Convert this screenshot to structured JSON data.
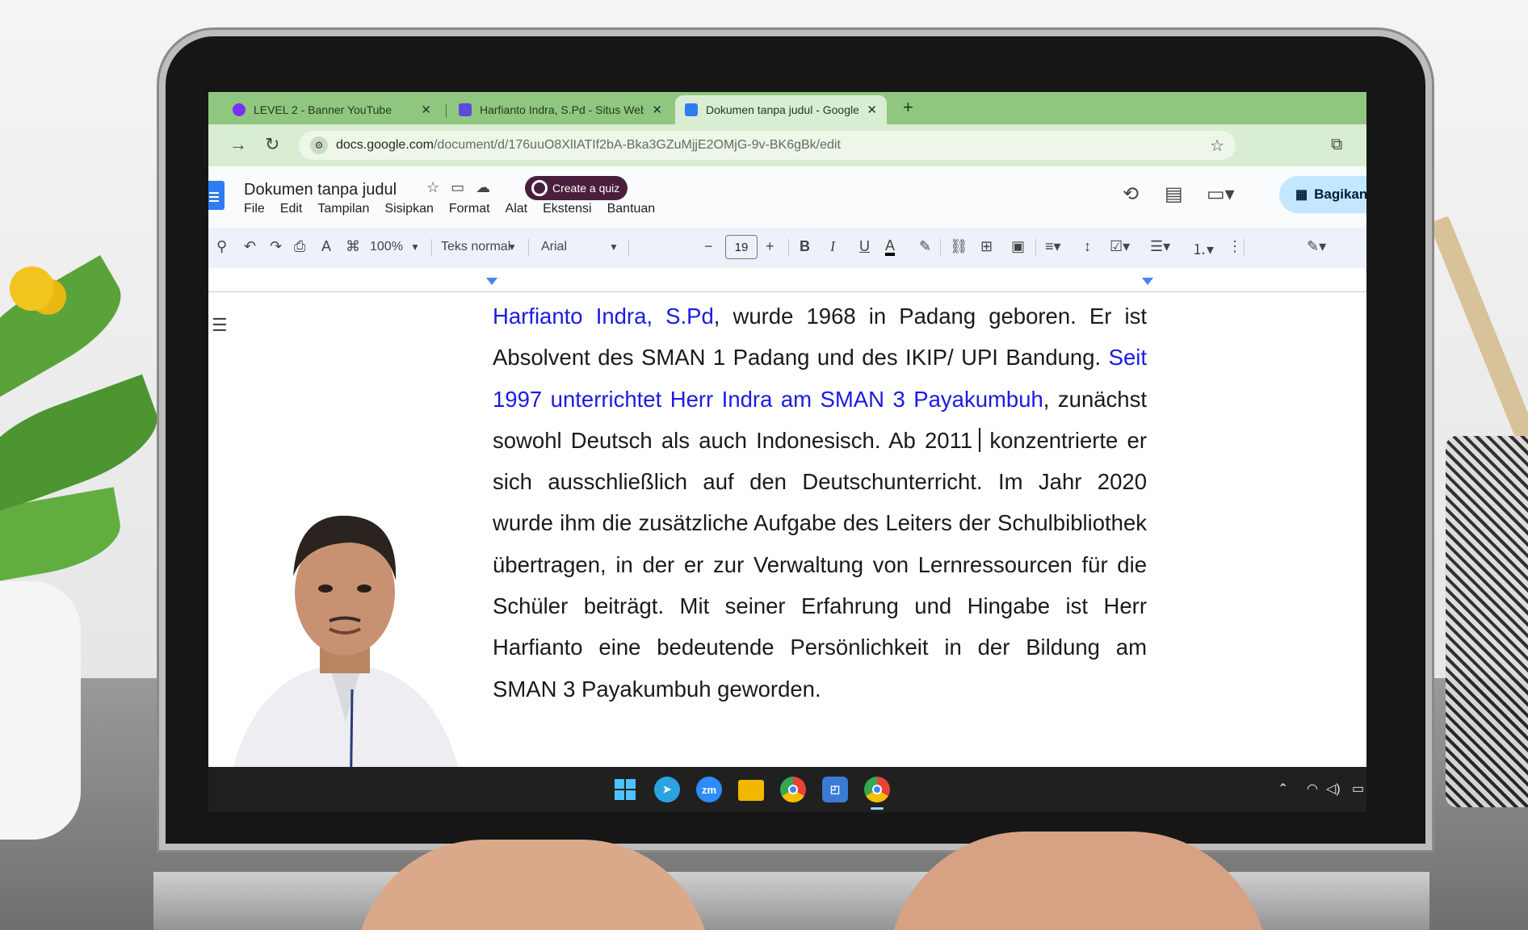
{
  "browser": {
    "tabs": [
      {
        "title": "LEVEL 2 - Banner YouTube",
        "close": "✕",
        "favicon_color": "#7b2ff7"
      },
      {
        "title": "Harfianto Indra, S.Pd - Situs Web",
        "close": "✕",
        "favicon_color": "#5b4bd6"
      },
      {
        "title": "Dokumen tanpa judul - Google Dokumen",
        "close": "✕",
        "favicon_color": "#2f7cf0"
      }
    ],
    "new_tab": "+",
    "url_domain": "docs.google.com",
    "url_path": "/document/d/176uuO8XlIATIf2bA-Bka3GZuMjjE2OMjG-9v-BK6gBk/edit",
    "tabbar_color": "#8fc780"
  },
  "docs": {
    "title": "Dokumen tanpa judul",
    "quiz_button": "Create a quiz",
    "menu": [
      "File",
      "Edit",
      "Tampilan",
      "Sisipkan",
      "Format",
      "Alat",
      "Ekstensi",
      "Bantuan"
    ],
    "share_label": "Bagikan",
    "toolbar": {
      "zoom": "100%",
      "style": "Teks normal",
      "font": "Arial",
      "font_size": "19",
      "bold": "B",
      "italic": "I",
      "underline": "U",
      "text_color": "A"
    }
  },
  "document": {
    "link_text": "Harfianto Indra, S.Pd",
    "p1_rest": ", wurde 1968 in Padang geboren. Er ist Absolvent des SMAN 1 Padang und des IKIP/ UPI Bandung. ",
    "blue_sentence": "Seit 1997 unterrichtet Herr Indra am SMAN 3 Payakumbuh",
    "p1_end": ", zunächst sowohl Deutsch als auch Indonesisch. Ab 2011",
    "p2": " konzentrierte er sich ausschließlich auf den Deutschunterricht. Im Jahr 2020 wurde ihm die zusätzliche Aufgabe des Leiters der Schulbibliothek übertragen, in der er zur Verwaltung von Lernressourcen für die Schüler beiträgt. Mit seiner Erfahrung und Hingabe ist Herr Harfianto eine bedeutende Persönlichkeit in der Bildung am SMAN 3 Payakumbuh geworden.",
    "link_color": "#1a1ae6"
  },
  "taskbar": {
    "apps": [
      "windows-start",
      "telegram",
      "zoom",
      "file-explorer",
      "chrome",
      "snipping-tool",
      "chrome-profile"
    ],
    "zoom_label": "zm"
  }
}
